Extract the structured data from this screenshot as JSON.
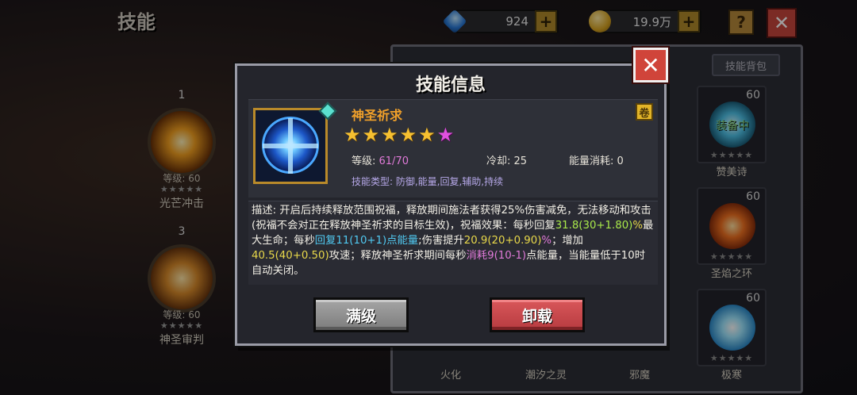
{
  "screen_title": "技能",
  "currency": {
    "gems": "924",
    "gold": "19.9万",
    "plus": "+"
  },
  "buttons": {
    "help": "?",
    "close": "✕",
    "bag": "技能背包"
  },
  "left_skills": [
    {
      "num": "1",
      "level": "等级: 60",
      "stars": "★★★★★",
      "name": "光芒冲击"
    },
    {
      "num": "3",
      "level": "等级: 60",
      "stars": "★★★★★",
      "name": "神圣审判"
    }
  ],
  "right_slots": [
    {
      "level": "60",
      "name": "赞美诗",
      "tag": "装备中",
      "stars": "★★★★★"
    },
    {
      "level": "60",
      "name": "圣焰之环",
      "stars": "★★★★★"
    },
    {
      "level": "60",
      "name": "极寒",
      "stars": "★★★★★"
    }
  ],
  "bottom_names": [
    "火化",
    "潮汐之灵",
    "邪魔"
  ],
  "modal": {
    "title": "技能信息",
    "close": "✕",
    "skill_name": "神圣祈求",
    "book": "卷",
    "stars": [
      "★",
      "★",
      "★",
      "★",
      "★",
      "★"
    ],
    "level_label": "等级: ",
    "level_value": "61/70",
    "cooldown": "冷却: 25",
    "energy": "能量消耗: 0",
    "types": "技能类型: 防御,能量,回复,辅助,持续",
    "desc": {
      "p1": "描述: 开启后持续释放范围祝福，释放期间施法者获得25%伤害减免，无法移动和攻击(祝福不会对正在释放神圣祈求的目标生效)，祝福效果：每秒回复",
      "v1": "31.8(30+1.80)",
      "u1": "%",
      "p2": "最大生命；每秒",
      "v2": "回复11(10+1)点能量",
      "p3": ";伤害提升",
      "v3": "20.9(20+0.90)",
      "u3": "%",
      "p4": "；增加",
      "v4": "40.5(40+0.50)",
      "p5": "攻速；释放神圣祈求期间每秒",
      "v5": "消耗9(10-1)",
      "p6": "点能量，当能量低于10时自动关闭。"
    },
    "btn_max": "满级",
    "btn_unload": "卸载"
  },
  "colors": {
    "accent_orange": "#f0a02a",
    "stat_pink": "#e07ad8",
    "green": "#a8e84a",
    "cyan": "#50c8f0",
    "gold": "#e8d84a"
  }
}
